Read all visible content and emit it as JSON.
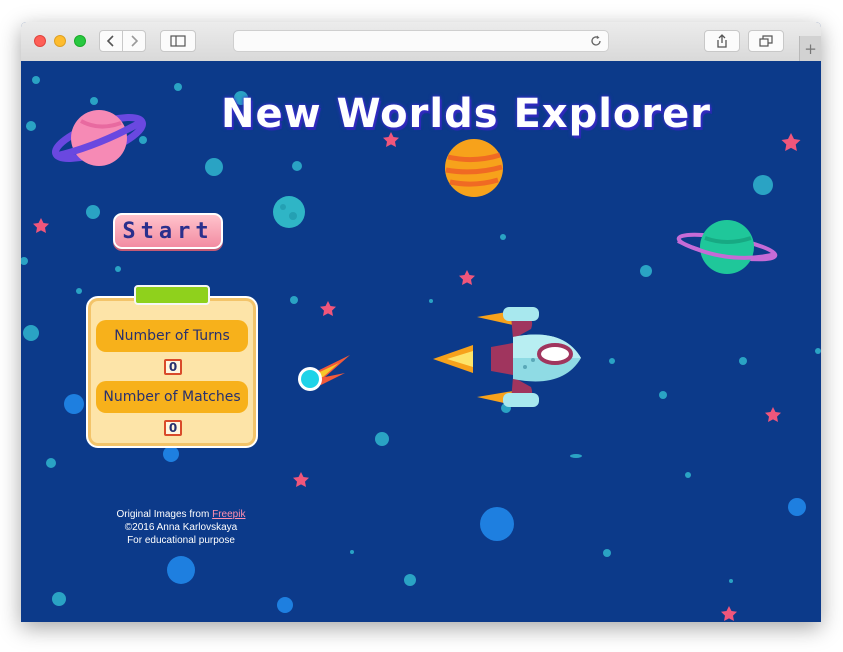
{
  "browser": {
    "back_icon": "chevron-left-icon",
    "forward_icon": "chevron-right-icon",
    "sidebar_icon": "sidebar-icon",
    "reload_icon": "reload-icon",
    "share_icon": "share-icon",
    "tabs_icon": "tabs-icon",
    "new_tab": "+"
  },
  "game": {
    "title": "New Worlds Explorer",
    "start_label": "Start",
    "turns_label": "Number of Turns",
    "turns_value": "0",
    "matches_label": "Number of Matches",
    "matches_value": "0"
  },
  "credits": {
    "line1_prefix": "Original Images from ",
    "line1_link": "Freepik",
    "line2": "©2016 Anna Karlovskaya",
    "line3": "For educational purpose"
  },
  "colors": {
    "background": "#0c3a8a",
    "title": "#ffffff",
    "start_button": "#f28ca2",
    "panel": "#fde4a8",
    "panel_label": "#f7b11b",
    "star": "#f0567b",
    "bubble": "#2aa3c4"
  }
}
